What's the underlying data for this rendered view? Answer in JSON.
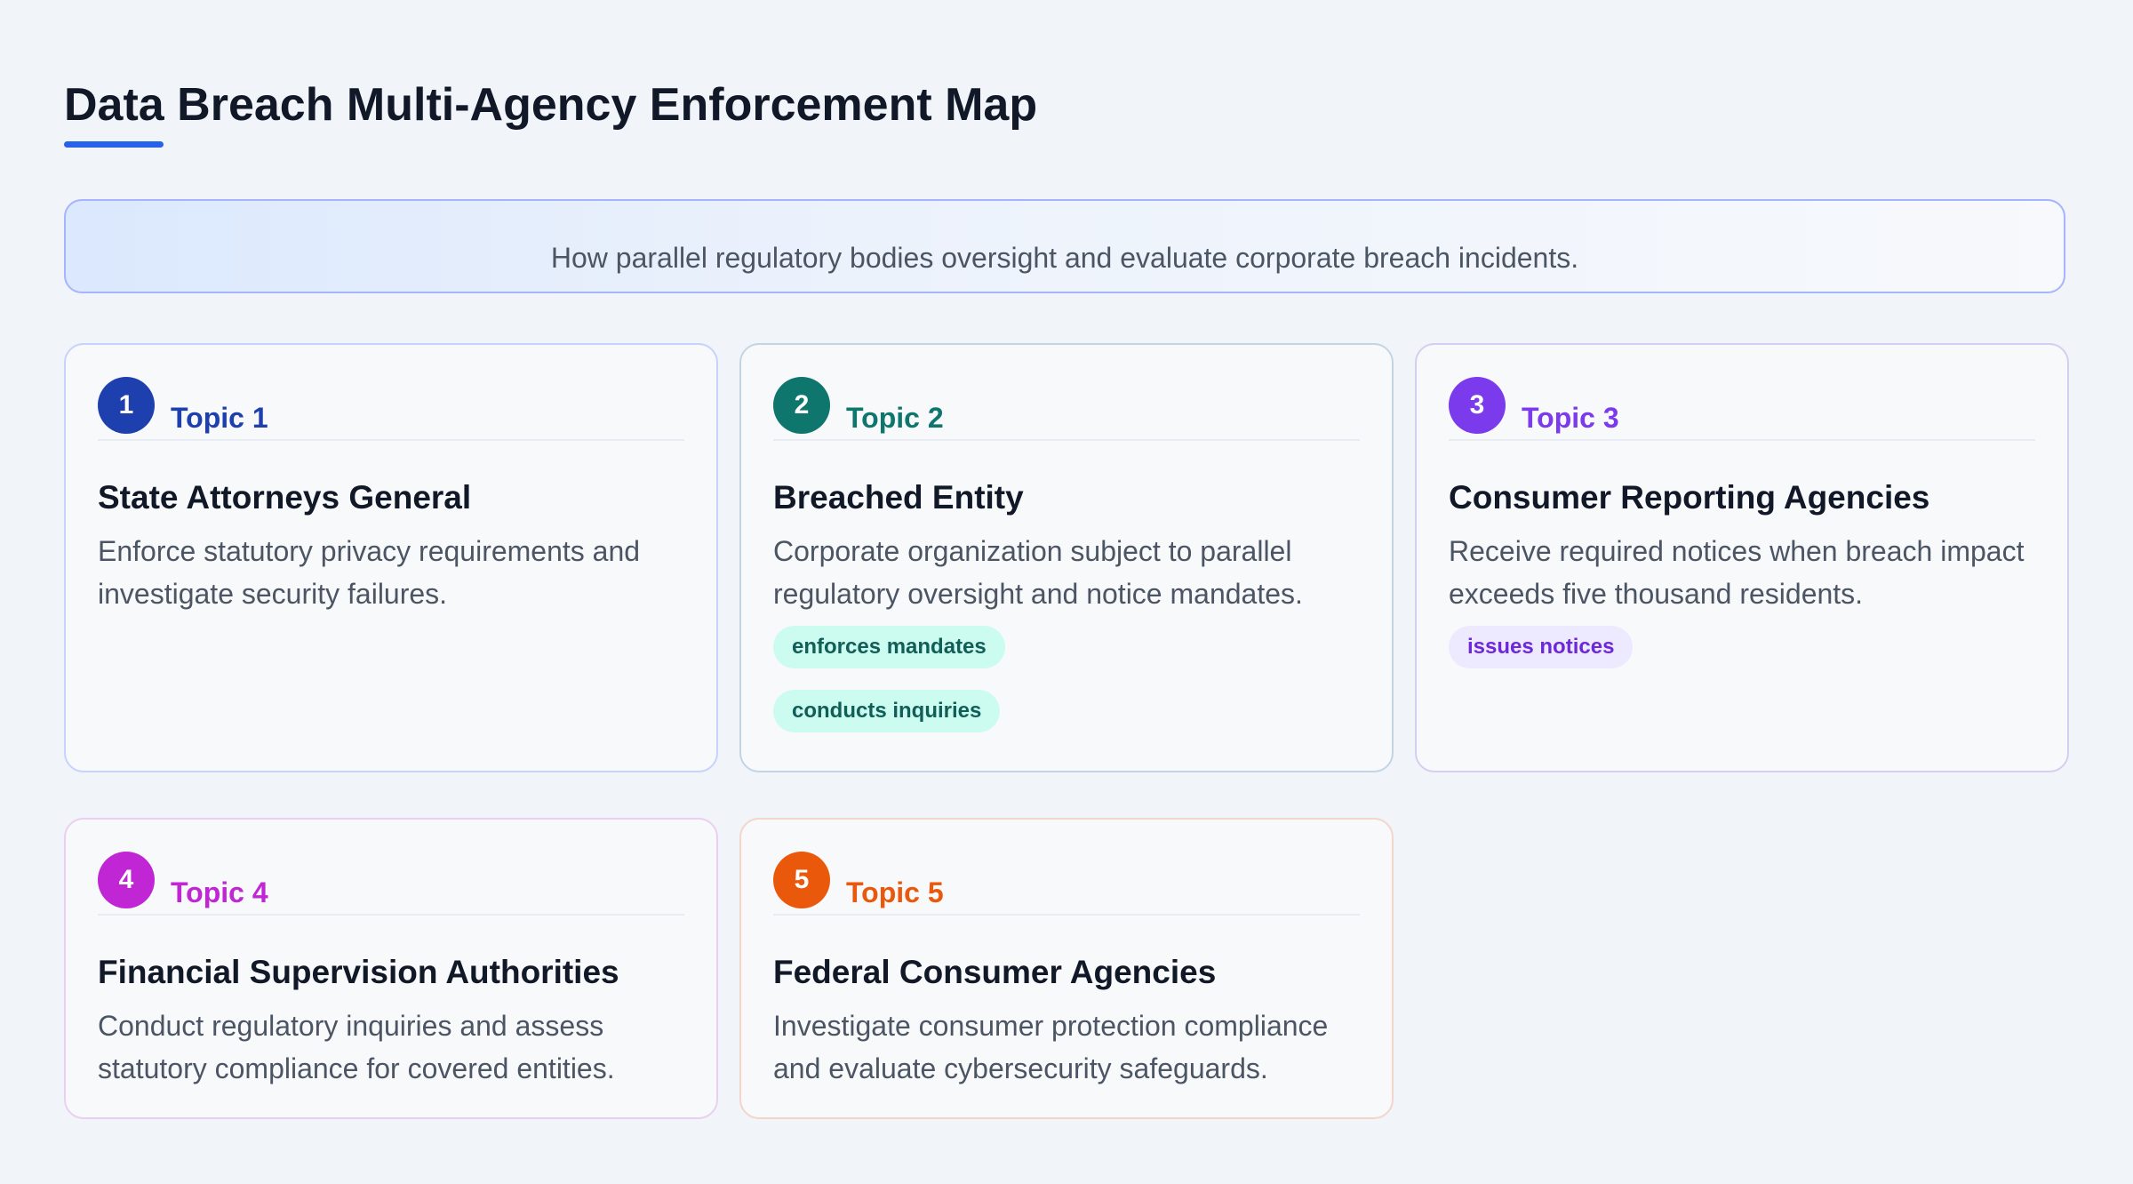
{
  "title": "Data Breach Multi-Agency Enforcement Map",
  "subtitle": "How parallel regulatory bodies oversight and evaluate corporate breach incidents.",
  "colors": {
    "accent": "#2563eb",
    "topic1": "#1e40af",
    "topic2": "#0f766e",
    "topic3": "#7c3aed",
    "topic4": "#c026d3",
    "topic5": "#ea580c"
  },
  "topics": [
    {
      "number": "1",
      "label": "Topic 1",
      "title": "State Attorneys General",
      "description": "Enforce statutory privacy requirements and investigate security failures.",
      "tags": []
    },
    {
      "number": "2",
      "label": "Topic 2",
      "title": "Breached Entity",
      "description": "Corporate organization subject to parallel regulatory oversight and notice mandates.",
      "tags": [
        "enforces mandates",
        "conducts inquiries"
      ]
    },
    {
      "number": "3",
      "label": "Topic 3",
      "title": "Consumer Reporting Agencies",
      "description": "Receive required notices when breach impact exceeds five thousand residents.",
      "tags": [
        "issues notices"
      ]
    },
    {
      "number": "4",
      "label": "Topic 4",
      "title": "Financial Supervision Authorities",
      "description": "Conduct regulatory inquiries and assess statutory compliance for covered entities.",
      "tags": []
    },
    {
      "number": "5",
      "label": "Topic 5",
      "title": "Federal Consumer Agencies",
      "description": "Investigate consumer protection compliance and evaluate cybersecurity safeguards.",
      "tags": []
    }
  ]
}
